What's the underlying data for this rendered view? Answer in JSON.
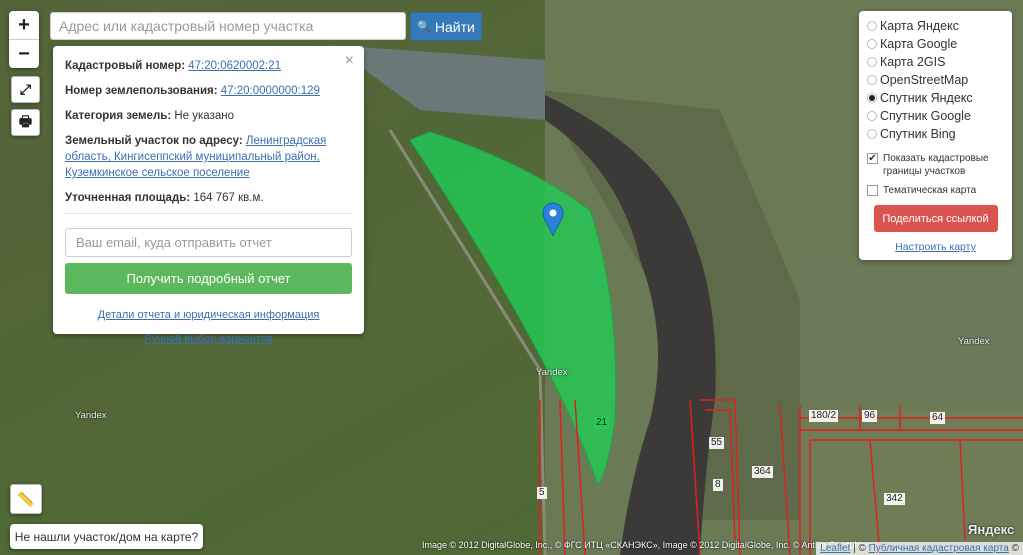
{
  "zoom": {
    "in": "+",
    "out": "−"
  },
  "icons": {
    "fullscreen": "⤢",
    "print": "🖶",
    "ruler": "📏",
    "search": "🔍"
  },
  "search": {
    "placeholder": "Адрес или кадастровый номер участка",
    "value": "",
    "button": "Найти"
  },
  "info": {
    "cadastral_label": "Кадастровый номер:",
    "cadastral_value": "47:20:0620002:21",
    "usage_label": "Номер землепользования:",
    "usage_value": "47:20:0000000:129",
    "category_label": "Категория земель:",
    "category_value": "Не указано",
    "address_label": "Земельный участок по адресу:",
    "address_value": "Ленинградская область, Кингисеппский муниципальный район, Куземкинское сельское поселение",
    "area_label": "Уточненная площадь:",
    "area_value": "164 767 кв.м.",
    "email_placeholder": "Ваш email, куда отправить отчет",
    "report_button": "Получить подробный отчет",
    "details_link": "Детали отчета и юридическая информация",
    "manual_link": "Ручной выбор вариантов",
    "close": "×"
  },
  "layers": {
    "options": [
      {
        "label": "Карта Яндекс",
        "selected": false
      },
      {
        "label": "Карта Google",
        "selected": false
      },
      {
        "label": "Карта 2GIS",
        "selected": false
      },
      {
        "label": "OpenStreetMap",
        "selected": false
      },
      {
        "label": "Спутник Яндекс",
        "selected": true
      },
      {
        "label": "Спутник Google",
        "selected": false
      },
      {
        "label": "Спутник Bing",
        "selected": false
      }
    ],
    "checkbox_cadastral": {
      "label": "Показать кадастровые границы участков",
      "checked": true
    },
    "checkbox_thematic": {
      "label": "Тематическая карта",
      "checked": false
    },
    "share_button": "Поделиться ссылкой",
    "configure_link": "Настроить карту"
  },
  "not_found": "Не нашли участок/дом на карте?",
  "attribution": "Image © 2012 DigitalGlobe, Inc., © ФГС ИТЦ «СКАНЭКС», Image © 2012 DigitalGlobe, Inc. © Antilia Consulting",
  "leaflet": {
    "leaflet": "Leaflet",
    "sep": " | © ",
    "public_map": "Публичная кадастровая карта",
    "copy": " ©"
  },
  "map_labels": {
    "yandex1": "Yandex",
    "yandex2": "Yandex",
    "yandex3": "Yandex",
    "yandex_logo": "Яндекс"
  },
  "parcels": {
    "p21": "21",
    "p5": "5",
    "p55": "55",
    "p8": "8",
    "p364": "364",
    "p342": "342",
    "p180": "180/2",
    "p96": "96",
    "p64": "64"
  },
  "colors": {
    "parcel_fill": "#22cc55",
    "cadastral_lines": "#e02020",
    "search_button": "#337ab7",
    "report_button": "#5cb85c",
    "share_button": "#d9534f"
  }
}
